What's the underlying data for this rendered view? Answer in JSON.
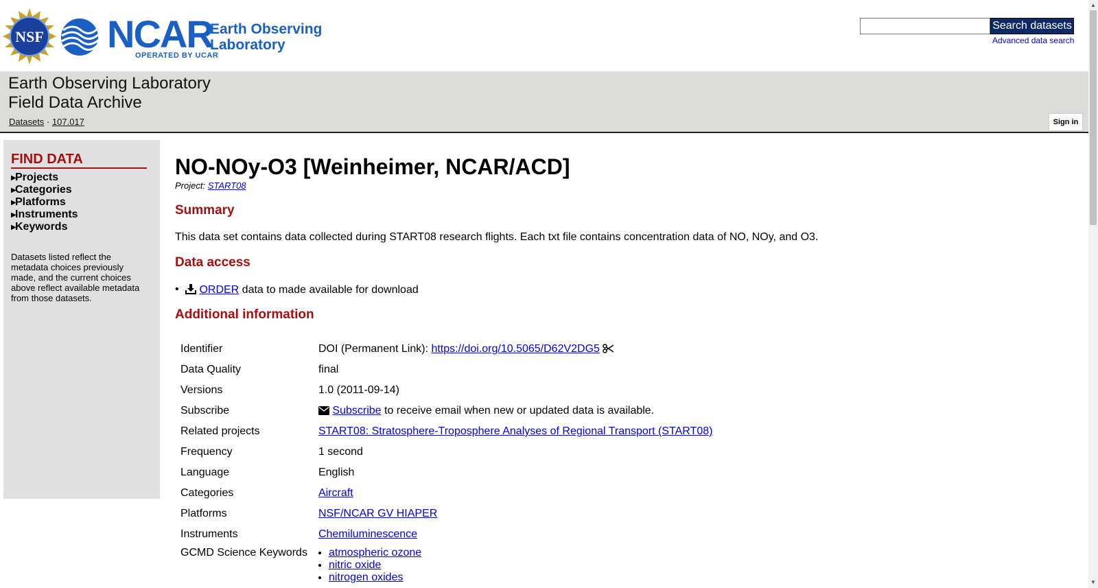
{
  "header": {
    "nsf_logo_text": "NSF",
    "ncar_logo_text": "NCAR",
    "ncar_operated_text": "OPERATED BY UCAR",
    "eol_logo_line1": "Earth Observing",
    "eol_logo_line2": "Laboratory",
    "search": {
      "placeholder": "",
      "button_label": "Search datasets",
      "advanced_label": "Advanced data search"
    }
  },
  "banner": {
    "title_line1": "Earth Observing Laboratory",
    "title_line2": "Field Data Archive",
    "breadcrumb": [
      {
        "label": "Datasets"
      },
      {
        "label": "107.017"
      }
    ],
    "breadcrumb_separator": "·",
    "sign_in_label": "Sign in"
  },
  "sidebar": {
    "heading": "FIND DATA",
    "facets": [
      {
        "label": "Projects"
      },
      {
        "label": "Categories"
      },
      {
        "label": "Platforms"
      },
      {
        "label": "Instruments"
      },
      {
        "label": "Keywords"
      }
    ],
    "note": "Datasets listed reflect the metadata choices previously made, and the current choices above reflect available metadata from those datasets."
  },
  "dataset": {
    "title": "NO-NOy-O3 [Weinheimer, NCAR/ACD]",
    "project_prefix": "Project:",
    "project_link": "START08",
    "summary_heading": "Summary",
    "summary_text": "This data set contains data collected during START08 research flights. Each txt file contains concentration data of NO, NOy, and O3.",
    "access_heading": "Data access",
    "access_items": [
      {
        "icon": "download-icon",
        "link": "ORDER",
        "text": " data to made available for download"
      }
    ],
    "additional_heading": "Additional information",
    "info": {
      "identifier": {
        "label": "Identifier",
        "prefix": "DOI (Permanent Link): ",
        "link": "https://doi.org/10.5065/D62V2DG5",
        "icon": "scissors-icon"
      },
      "data_quality": {
        "label": "Data Quality",
        "value": "final"
      },
      "versions": {
        "label": "Versions",
        "value": "1.0 (2011-09-14)"
      },
      "subscribe": {
        "label": "Subscribe",
        "icon": "envelope-icon",
        "link": "Subscribe",
        "text": " to receive email when new or updated data is available."
      },
      "related_projects": {
        "label": "Related projects",
        "link": "START08: Stratosphere-Troposphere Analyses of Regional Transport (START08)"
      },
      "frequency": {
        "label": "Frequency",
        "value": "1 second"
      },
      "language": {
        "label": "Language",
        "value": "English"
      },
      "categories": {
        "label": "Categories",
        "link": "Aircraft"
      },
      "platforms": {
        "label": "Platforms",
        "link": "NSF/NCAR GV HIAPER"
      },
      "instruments": {
        "label": "Instruments",
        "link": "Chemiluminescence"
      },
      "gcmd_keywords": {
        "label": "GCMD Science Keywords",
        "items": [
          "atmospheric ozone",
          "nitric oxide",
          "nitrogen oxides"
        ]
      }
    }
  },
  "colors": {
    "heading_red": "#a50f0f",
    "banner_gray": "#dcdcd8",
    "sidebar_gray": "#e0e0e0",
    "search_button": "#0e2a66",
    "brand_blue": "#1a5fc4",
    "link_blue": "#0000ee"
  }
}
